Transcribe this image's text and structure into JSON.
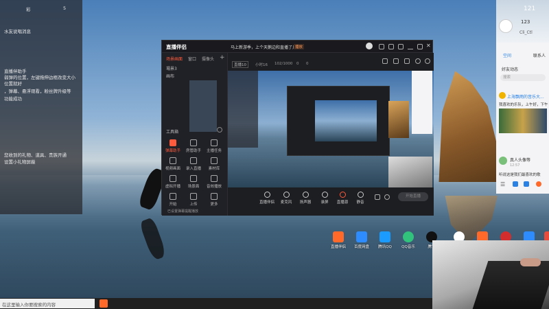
{
  "left_chat": {
    "top_numbers": [
      "彩",
      "5"
    ],
    "lines": [
      "水友说唱消息",
      "直播伴助手",
      "弱弹的位置，左键拖伸边框改变大小",
      "位置就好",
      "，弹幕、悬浮观看，粉丝牌升级等",
      "功能成功",
      "您收到的礼物、道具、贵族开通",
      "设置小礼物屏蔽"
    ]
  },
  "app": {
    "logo": "直播伴侣",
    "title": "马上新游季，上个天鹅边和直播了几次",
    "title_tag": "播放",
    "sidebar_tabs": [
      "场景画面",
      "窗口",
      "摄像头"
    ],
    "scenes": [
      "場景3",
      "画布"
    ],
    "stream_meta": [
      "直播10",
      "小时16",
      "102/1000",
      "0",
      "0"
    ],
    "toolbox_label": "工具箱",
    "tools": [
      "弹幕助手",
      "房管助手",
      "主播任务",
      "视频画面",
      "录入直播",
      "素材库",
      "虚拟开播",
      "场景面",
      "音效播放",
      "开始",
      "上传",
      "更多"
    ],
    "footer_note": "已设置弹幕提醒播放",
    "controls": [
      "直播伴侣",
      "麦克风",
      "扬声器",
      "录屏",
      "直播源",
      "静音"
    ],
    "start_button": "开始直播"
  },
  "right_panel": {
    "time_top": "121",
    "count": "123",
    "sub": "Cli_Ctl",
    "tabs": [
      "空间",
      "联系人"
    ],
    "filter": "好友动态",
    "search_placeholder": "搜索",
    "post1": "上海飘雨的音乐大...",
    "post1_text": "我喜欢的乐队，上午好，下午",
    "post2_user": "真人头像等",
    "post2_time": "12:57",
    "post2_text": "听说这是我们最喜欢的歌"
  },
  "desktop_icons": [
    {
      "label": "直播伴侣",
      "color": "#ff6a2a"
    },
    {
      "label": "百度网盘",
      "color": "#2f8cff"
    },
    {
      "label": "腾讯QQ",
      "color": "#1c9bff"
    },
    {
      "label": "QQ音乐",
      "color": "#31c27c"
    },
    {
      "label": "腾讯",
      "color": "#111111"
    },
    {
      "label": "",
      "color": "#ffffff"
    },
    {
      "label": "",
      "color": "#ff6a2a"
    },
    {
      "label": "",
      "color": "#d32d2d"
    },
    {
      "label": "",
      "color": "#2f8cff"
    },
    {
      "label": "",
      "color": "#e74c3c"
    }
  ],
  "taskbar": {
    "search_placeholder": "在这里输入你要搜索的内容"
  }
}
